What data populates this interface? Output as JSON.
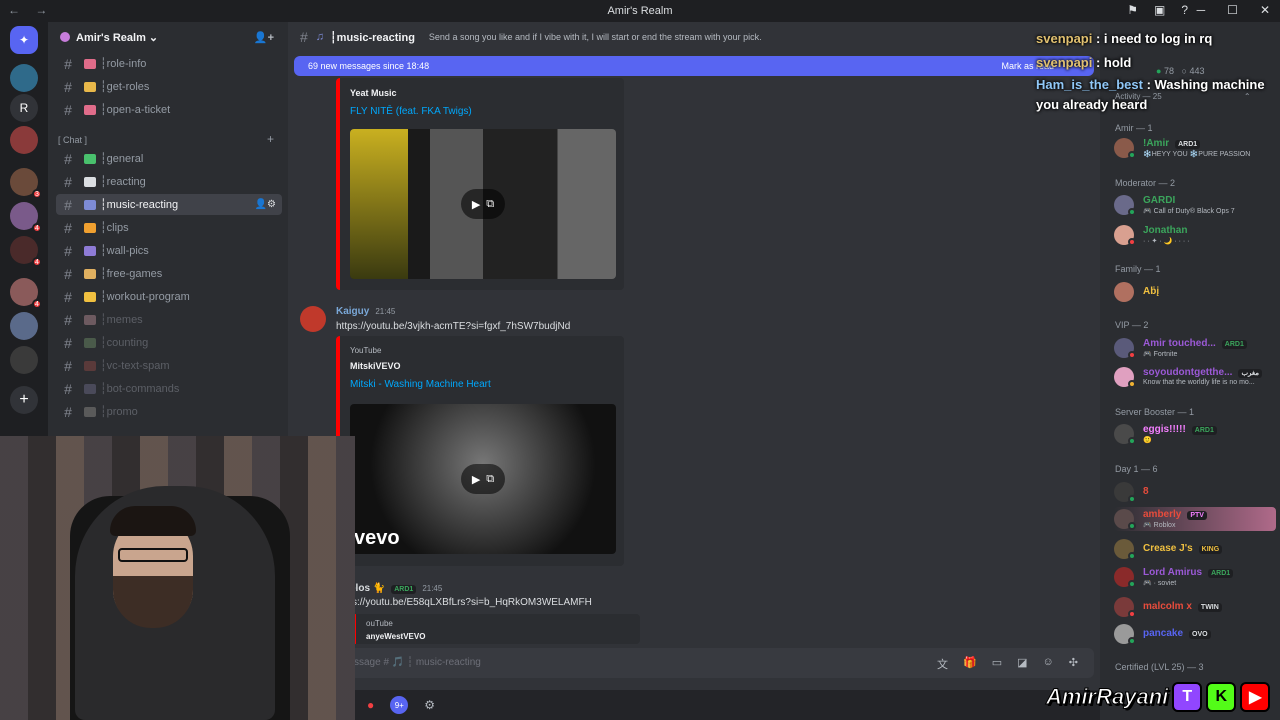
{
  "window": {
    "title": "Amir's Realm",
    "nav_arrows": "← →",
    "icons": [
      "flag-icon",
      "inbox-icon",
      "help-icon"
    ],
    "controls": [
      "─",
      "☐",
      "✕"
    ]
  },
  "guilds": {
    "home_icon": "discord-icon",
    "letter_server": "R",
    "badges": [
      "3",
      "4",
      "4",
      "4"
    ],
    "add_icon": "+"
  },
  "server": {
    "name": "Amir's Realm ⌄",
    "invite_icon": "add-user-icon",
    "category_chat": "[ Chat ]",
    "channels_top": [
      {
        "name": "┆role-info",
        "color": "#e06c8a"
      },
      {
        "name": "┆get-roles",
        "color": "#e8b84a"
      },
      {
        "name": "┆open-a-ticket",
        "color": "#e06c8a"
      }
    ],
    "channels_chat": [
      {
        "name": "┆general",
        "color": "#49c16d",
        "dim": false,
        "active": false
      },
      {
        "name": "┆reacting",
        "color": "#dbdee1",
        "dim": false,
        "active": false
      },
      {
        "name": "┆music-reacting",
        "color": "#7d8bd6",
        "dim": false,
        "active": true
      },
      {
        "name": "┆clips",
        "color": "#f0a030",
        "dim": false,
        "active": false
      },
      {
        "name": "┆wall-pics",
        "color": "#8e7bd6",
        "dim": false,
        "active": false
      },
      {
        "name": "┆free-games",
        "color": "#e0b060",
        "dim": false,
        "active": false
      },
      {
        "name": "┆workout-program",
        "color": "#f0c040",
        "dim": false,
        "active": false
      },
      {
        "name": "┆memes",
        "color": "#6d5a60",
        "dim": true,
        "active": false
      },
      {
        "name": "┆counting",
        "color": "#4a5a4a",
        "dim": true,
        "active": false
      },
      {
        "name": "┆vc-text-spam",
        "color": "#5a3a3a",
        "dim": true,
        "active": false
      },
      {
        "name": "┆bot-commands",
        "color": "#4a4a5a",
        "dim": true,
        "active": false
      },
      {
        "name": "┆promo",
        "color": "#5a5a5a",
        "dim": true,
        "active": false
      }
    ]
  },
  "chat": {
    "channel_name": "┆music-reacting",
    "channel_icon": "music-note-icon",
    "topic": "Send a song you like and if I vibe with it, I will start or end the stream with your pick.",
    "new_banner": "69 new messages since 18:48",
    "mark_as_read": "Mark as read",
    "embed1": {
      "author": "Yeat Music",
      "title": "FLY NITĒ (feat. FKA Twigs)"
    },
    "message2": {
      "user": "Kaiguy",
      "time": "21:45",
      "link": "https://youtu.be/3vjkh-acmTE?si=fgxf_7hSW7budjNd",
      "embed": {
        "provider": "YouTube",
        "author": "MitskiVEVO",
        "title": "Mitski - Washing Machine Heart",
        "watermark": "vevo"
      }
    },
    "message3": {
      "user": "elos 🐈",
      "tag": "ARD1",
      "time": "21:45",
      "link": "s://youtu.be/E58qLXBfLrs?si=b_HqRkOM3WELAMFH",
      "embed": {
        "provider": "ouTube",
        "author": "anyeWestVEVO"
      }
    },
    "composer_placeholder": "ssage # 🎵 ┆ music-reacting"
  },
  "members": {
    "stats_online": "78",
    "stats_total": "443",
    "activity": "Activity — 25",
    "groups": [
      {
        "label": "Amir — 1"
      },
      {
        "label": "Moderator — 2"
      },
      {
        "label": "Family — 1"
      },
      {
        "label": "VIP — 2"
      },
      {
        "label": "Server Booster — 1"
      },
      {
        "label": "Day 1 — 6"
      },
      {
        "label": "Certified (LVL 25) — 3"
      }
    ],
    "list": [
      {
        "name": "!Amir",
        "color": "#3ba55c",
        "tag": "ARD1",
        "sub": "❄️HEYY YOU ❄️PURE PASSION"
      },
      {
        "name": "GARDI",
        "color": "#3ba55c",
        "tag": "",
        "sub": "🎮 Call of Duty® Black Ops 7"
      },
      {
        "name": "Jonathan",
        "color": "#3ba55c",
        "tag": "",
        "sub": "· · ✦ · 🌙 · · · ·"
      },
      {
        "name": "Aḃį",
        "color": "#f0c040",
        "tag": "",
        "sub": ""
      },
      {
        "name": "Amir touched...",
        "color": "#9b59d6",
        "tag": "ARD1",
        "sub": "🎮 Fortnite"
      },
      {
        "name": "soyoudontgetthe...",
        "color": "#9b59d6",
        "tag": "مغرب",
        "sub": "Know that the worldly life is no mo..."
      },
      {
        "name": "eggis!!!!!",
        "color": "#f47fff",
        "tag": "ARD1",
        "sub": "🙂"
      },
      {
        "name": "8",
        "color": "#e74c3c",
        "tag": "",
        "sub": ""
      },
      {
        "name": "amberly",
        "color": "#e74c3c",
        "tag": "PTV",
        "sub": "🎮 Roblox"
      },
      {
        "name": "Crease J's",
        "color": "#f0c040",
        "tag": "KING",
        "sub": ""
      },
      {
        "name": "Lord Amirus",
        "color": "#9b59d6",
        "tag": "ARD1",
        "sub": "🎮 · soviet"
      },
      {
        "name": "malcolm x",
        "color": "#e74c3c",
        "tag": "TWIN",
        "sub": ""
      },
      {
        "name": "pancake",
        "color": "#5865f2",
        "tag": "OVO",
        "sub": ""
      }
    ]
  },
  "overlay": {
    "lines": [
      {
        "user": "svenpapi",
        "text": ": i need to log in rq"
      },
      {
        "user": "svenpapi",
        "text": ": hold"
      },
      {
        "user": "Ham_is_the_best",
        "text": ": Washing machine you already heard"
      }
    ],
    "streamer": "AmirRayani",
    "logos": [
      "T",
      "K",
      "▶"
    ]
  },
  "bottom_bar": {
    "icons": [
      "mic-icon",
      "discord-notif-icon",
      "settings-icon"
    ],
    "notif_badge": "9+"
  }
}
